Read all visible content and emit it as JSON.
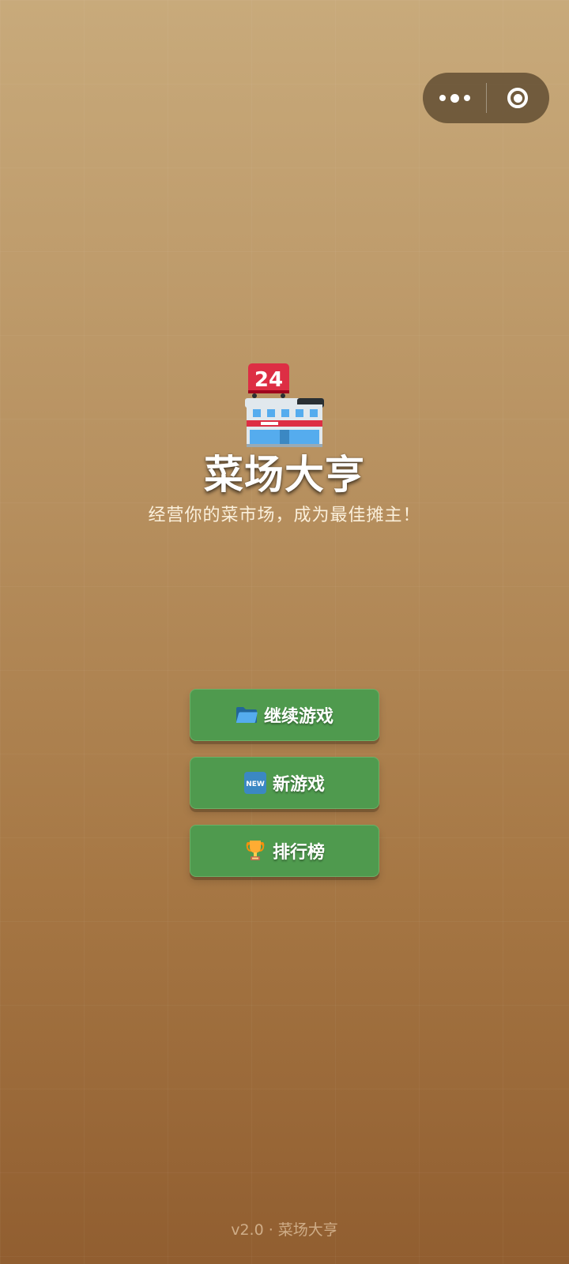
{
  "capsule": {
    "more_icon": "more-dots-icon",
    "close_icon": "close-target-icon"
  },
  "hero": {
    "icon": "store-24h-icon",
    "icon_badge": "24",
    "title": "菜场大亨",
    "subtitle": "经营你的菜市场，成为最佳摊主！"
  },
  "menu": {
    "buttons": [
      {
        "icon": "folder-icon",
        "label": "继续游戏"
      },
      {
        "icon": "new-badge-icon",
        "icon_text": "NEW",
        "label": "新游戏"
      },
      {
        "icon": "trophy-icon",
        "label": "排行榜"
      }
    ]
  },
  "footer": {
    "text": "v2.0 · 菜场大亨"
  },
  "colors": {
    "background_top": "#c8aa7b",
    "background_bottom": "#915e30",
    "button_green": "#4f9a4e",
    "capsule": "#5a462d"
  }
}
